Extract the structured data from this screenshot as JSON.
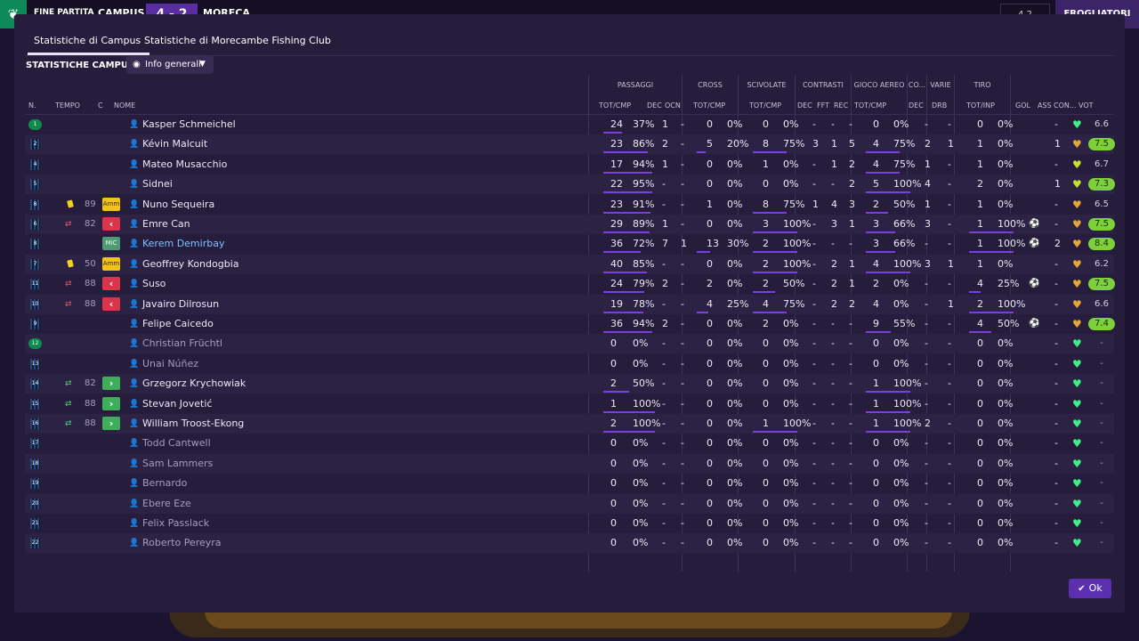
{
  "topbar": {
    "match_label": "FINE PARTITA",
    "home": "CAMPUS",
    "score": "4 - 2",
    "away": "MORECA",
    "right_small": "4 2",
    "right_button": "FROGLIATORI"
  },
  "tabs": [
    {
      "label": "Statistiche di Campus",
      "active": true
    },
    {
      "label": "Statistiche di Morecambe Fishing Club",
      "active": false
    }
  ],
  "section_title": "STATISTICHE CAMPUS",
  "view_dropdown": {
    "label": "Info generali"
  },
  "groups": [
    "PASSAGGI",
    "CROSS",
    "SCIVOLATE",
    "CONTRASTI",
    "GIOCO AEREO",
    "CO...",
    "VARIE",
    "TIRO"
  ],
  "columns": {
    "n": "N.",
    "tempo": "TEMPO",
    "c": "C",
    "nome": "NOME",
    "pass": "TOT/CMP",
    "dec": "DEC",
    "ocn": "OCN",
    "cross": "TOT/CMP",
    "sciv": "TOT/CMP",
    "cdec": "DEC",
    "fft": "FFT",
    "rec": "REC",
    "aereo": "TOT/CMP",
    "codec": "DEC",
    "drb": "DRB",
    "tiro": "TOT/INP",
    "gol": "GOL",
    "ass": "ASS",
    "con": "CON...",
    "vot": "VOT"
  },
  "players": [
    {
      "n": "1",
      "min": "",
      "chip": "",
      "name": "Kasper Schmeichel",
      "pt": "24",
      "pp": "37%",
      "pd": "1",
      "po": "-",
      "ct": "0",
      "cp": "0%",
      "st": "0",
      "sp": "0%",
      "kd": "-",
      "kf": "-",
      "kr": "-",
      "at": "0",
      "ap": "0%",
      "od": "-",
      "dr": "-",
      "tt": "0",
      "tp": "0%",
      "gol": "",
      "ass": "-",
      "con": "g",
      "vot": "6.6",
      "mult": 0.37
    },
    {
      "n": "2",
      "min": "",
      "chip": "",
      "name": "Kévin Malcuit",
      "pt": "23",
      "pp": "86%",
      "pd": "2",
      "po": "-",
      "ct": "5",
      "cp": "20%",
      "st": "8",
      "sp": "75%",
      "kd": "3",
      "kf": "1",
      "kr": "5",
      "at": "4",
      "ap": "75%",
      "od": "2",
      "dr": "1",
      "tt": "1",
      "tp": "0%",
      "gol": "",
      "ass": "1",
      "con": "o",
      "vot": "7.5"
    },
    {
      "n": "4",
      "min": "",
      "chip": "",
      "name": "Mateo Musacchio",
      "pt": "17",
      "pp": "94%",
      "pd": "1",
      "po": "-",
      "ct": "0",
      "cp": "0%",
      "st": "1",
      "sp": "0%",
      "kd": "-",
      "kf": "1",
      "kr": "2",
      "at": "4",
      "ap": "75%",
      "od": "1",
      "dr": "-",
      "tt": "1",
      "tp": "0%",
      "gol": "",
      "ass": "-",
      "con": "y",
      "vot": "6.7"
    },
    {
      "n": "5",
      "min": "",
      "chip": "",
      "name": "Sidnei",
      "pt": "22",
      "pp": "95%",
      "pd": "-",
      "po": "-",
      "ct": "0",
      "cp": "0%",
      "st": "0",
      "sp": "0%",
      "kd": "-",
      "kf": "-",
      "kr": "2",
      "at": "5",
      "ap": "100%",
      "od": "4",
      "dr": "-",
      "tt": "2",
      "tp": "0%",
      "gol": "",
      "ass": "1",
      "con": "y",
      "vot": "7.3"
    },
    {
      "n": "8",
      "min": "89",
      "chip": "Amm",
      "name": "Nuno Sequeira",
      "pt": "23",
      "pp": "91%",
      "pd": "-",
      "po": "-",
      "ct": "1",
      "cp": "0%",
      "st": "8",
      "sp": "75%",
      "kd": "1",
      "kf": "4",
      "kr": "3",
      "at": "2",
      "ap": "50%",
      "od": "1",
      "dr": "-",
      "tt": "1",
      "tp": "0%",
      "gol": "",
      "ass": "-",
      "con": "o",
      "vot": "6.5"
    },
    {
      "n": "6",
      "min": "82",
      "chip": "out",
      "name": "Emre Can",
      "pt": "29",
      "pp": "89%",
      "pd": "1",
      "po": "-",
      "ct": "0",
      "cp": "0%",
      "st": "3",
      "sp": "100%",
      "kd": "-",
      "kf": "3",
      "kr": "1",
      "at": "3",
      "ap": "66%",
      "od": "3",
      "dr": "-",
      "tt": "1",
      "tp": "100%",
      "gol": "ball",
      "ass": "-",
      "con": "o",
      "vot": "7.5"
    },
    {
      "n": "8",
      "min": "",
      "chip": "MiC",
      "name": "Kerem Demirbay",
      "pt": "36",
      "pp": "72%",
      "pd": "7",
      "po": "1",
      "ct": "13",
      "cp": "30%",
      "st": "2",
      "sp": "100%",
      "kd": "-",
      "kf": "-",
      "kr": "-",
      "at": "3",
      "ap": "66%",
      "od": "-",
      "dr": "-",
      "tt": "1",
      "tp": "100%",
      "gol": "ball",
      "ass": "2",
      "con": "o",
      "vot": "8.4",
      "link": true
    },
    {
      "n": "7",
      "min": "50",
      "chip": "Amm",
      "name": "Geoffrey Kondogbia",
      "pt": "40",
      "pp": "85%",
      "pd": "-",
      "po": "-",
      "ct": "0",
      "cp": "0%",
      "st": "2",
      "sp": "100%",
      "kd": "-",
      "kf": "2",
      "kr": "1",
      "at": "4",
      "ap": "100%",
      "od": "3",
      "dr": "1",
      "tt": "1",
      "tp": "0%",
      "gol": "",
      "ass": "-",
      "con": "o",
      "vot": "6.2"
    },
    {
      "n": "11",
      "min": "88",
      "chip": "out",
      "name": "Suso",
      "pt": "24",
      "pp": "79%",
      "pd": "2",
      "po": "-",
      "ct": "2",
      "cp": "0%",
      "st": "2",
      "sp": "50%",
      "kd": "-",
      "kf": "2",
      "kr": "1",
      "at": "2",
      "ap": "0%",
      "od": "-",
      "dr": "-",
      "tt": "4",
      "tp": "25%",
      "gol": "ball",
      "ass": "-",
      "con": "o",
      "vot": "7.5"
    },
    {
      "n": "10",
      "min": "88",
      "chip": "out",
      "name": "Javairo Dilrosun",
      "pt": "19",
      "pp": "78%",
      "pd": "-",
      "po": "-",
      "ct": "4",
      "cp": "25%",
      "st": "4",
      "sp": "75%",
      "kd": "-",
      "kf": "2",
      "kr": "2",
      "at": "4",
      "ap": "0%",
      "od": "-",
      "dr": "1",
      "tt": "2",
      "tp": "100%",
      "gol": "",
      "ass": "-",
      "con": "o",
      "vot": "6.6"
    },
    {
      "n": "9",
      "min": "",
      "chip": "",
      "name": "Felipe Caicedo",
      "pt": "36",
      "pp": "94%",
      "pd": "2",
      "po": "-",
      "ct": "0",
      "cp": "0%",
      "st": "2",
      "sp": "0%",
      "kd": "-",
      "kf": "-",
      "kr": "-",
      "at": "9",
      "ap": "55%",
      "od": "-",
      "dr": "-",
      "tt": "4",
      "tp": "50%",
      "gol": "ball",
      "ass": "-",
      "con": "o",
      "vot": "7.4"
    },
    {
      "n": "12",
      "min": "",
      "chip": "",
      "name": "Christian Früchtl",
      "pt": "0",
      "pp": "0%",
      "pd": "-",
      "po": "-",
      "ct": "0",
      "cp": "0%",
      "st": "0",
      "sp": "0%",
      "kd": "-",
      "kf": "-",
      "kr": "-",
      "at": "0",
      "ap": "0%",
      "od": "-",
      "dr": "-",
      "tt": "0",
      "tp": "0%",
      "gol": "",
      "ass": "-",
      "con": "g",
      "vot": "-",
      "dim": true
    },
    {
      "n": "13",
      "min": "",
      "chip": "",
      "name": "Unai Núñez",
      "pt": "0",
      "pp": "0%",
      "pd": "-",
      "po": "-",
      "ct": "0",
      "cp": "0%",
      "st": "0",
      "sp": "0%",
      "kd": "-",
      "kf": "-",
      "kr": "-",
      "at": "0",
      "ap": "0%",
      "od": "-",
      "dr": "-",
      "tt": "0",
      "tp": "0%",
      "gol": "",
      "ass": "-",
      "con": "g",
      "vot": "-",
      "dim": true
    },
    {
      "n": "14",
      "min": "82",
      "chip": "in",
      "name": "Grzegorz Krychowiak",
      "pt": "2",
      "pp": "50%",
      "pd": "-",
      "po": "-",
      "ct": "0",
      "cp": "0%",
      "st": "0",
      "sp": "0%",
      "kd": "-",
      "kf": "-",
      "kr": "-",
      "at": "1",
      "ap": "100%",
      "od": "-",
      "dr": "-",
      "tt": "0",
      "tp": "0%",
      "gol": "",
      "ass": "-",
      "con": "g",
      "vot": "-"
    },
    {
      "n": "15",
      "min": "88",
      "chip": "in",
      "name": "Stevan Jovetić",
      "pt": "1",
      "pp": "100%",
      "pd": "-",
      "po": "-",
      "ct": "0",
      "cp": "0%",
      "st": "0",
      "sp": "0%",
      "kd": "-",
      "kf": "-",
      "kr": "-",
      "at": "1",
      "ap": "100%",
      "od": "-",
      "dr": "-",
      "tt": "0",
      "tp": "0%",
      "gol": "",
      "ass": "-",
      "con": "g",
      "vot": "-"
    },
    {
      "n": "16",
      "min": "88",
      "chip": "in",
      "name": "William Troost-Ekong",
      "pt": "2",
      "pp": "100%",
      "pd": "-",
      "po": "-",
      "ct": "0",
      "cp": "0%",
      "st": "1",
      "sp": "100%",
      "kd": "-",
      "kf": "-",
      "kr": "-",
      "at": "1",
      "ap": "100%",
      "od": "2",
      "dr": "-",
      "tt": "0",
      "tp": "0%",
      "gol": "",
      "ass": "-",
      "con": "g",
      "vot": "-"
    },
    {
      "n": "17",
      "min": "",
      "chip": "",
      "name": "Todd Cantwell",
      "pt": "0",
      "pp": "0%",
      "pd": "-",
      "po": "-",
      "ct": "0",
      "cp": "0%",
      "st": "0",
      "sp": "0%",
      "kd": "-",
      "kf": "-",
      "kr": "-",
      "at": "0",
      "ap": "0%",
      "od": "-",
      "dr": "-",
      "tt": "0",
      "tp": "0%",
      "gol": "",
      "ass": "-",
      "con": "g",
      "vot": "-",
      "dim": true
    },
    {
      "n": "18",
      "min": "",
      "chip": "",
      "name": "Sam Lammers",
      "pt": "0",
      "pp": "0%",
      "pd": "-",
      "po": "-",
      "ct": "0",
      "cp": "0%",
      "st": "0",
      "sp": "0%",
      "kd": "-",
      "kf": "-",
      "kr": "-",
      "at": "0",
      "ap": "0%",
      "od": "-",
      "dr": "-",
      "tt": "0",
      "tp": "0%",
      "gol": "",
      "ass": "-",
      "con": "g",
      "vot": "-",
      "dim": true
    },
    {
      "n": "19",
      "min": "",
      "chip": "",
      "name": "Bernardo",
      "pt": "0",
      "pp": "0%",
      "pd": "-",
      "po": "-",
      "ct": "0",
      "cp": "0%",
      "st": "0",
      "sp": "0%",
      "kd": "-",
      "kf": "-",
      "kr": "-",
      "at": "0",
      "ap": "0%",
      "od": "-",
      "dr": "-",
      "tt": "0",
      "tp": "0%",
      "gol": "",
      "ass": "-",
      "con": "g",
      "vot": "-",
      "dim": true
    },
    {
      "n": "20",
      "min": "",
      "chip": "",
      "name": "Ebere Eze",
      "pt": "0",
      "pp": "0%",
      "pd": "-",
      "po": "-",
      "ct": "0",
      "cp": "0%",
      "st": "0",
      "sp": "0%",
      "kd": "-",
      "kf": "-",
      "kr": "-",
      "at": "0",
      "ap": "0%",
      "od": "-",
      "dr": "-",
      "tt": "0",
      "tp": "0%",
      "gol": "",
      "ass": "-",
      "con": "g",
      "vot": "-",
      "dim": true
    },
    {
      "n": "21",
      "min": "",
      "chip": "",
      "name": "Felix Passlack",
      "pt": "0",
      "pp": "0%",
      "pd": "-",
      "po": "-",
      "ct": "0",
      "cp": "0%",
      "st": "0",
      "sp": "0%",
      "kd": "-",
      "kf": "-",
      "kr": "-",
      "at": "0",
      "ap": "0%",
      "od": "-",
      "dr": "-",
      "tt": "0",
      "tp": "0%",
      "gol": "",
      "ass": "-",
      "con": "g",
      "vot": "-",
      "dim": true
    },
    {
      "n": "22",
      "min": "",
      "chip": "",
      "name": "Roberto Pereyra",
      "pt": "0",
      "pp": "0%",
      "pd": "-",
      "po": "-",
      "ct": "0",
      "cp": "0%",
      "st": "0",
      "sp": "0%",
      "kd": "-",
      "kf": "-",
      "kr": "-",
      "at": "0",
      "ap": "0%",
      "od": "-",
      "dr": "-",
      "tt": "0",
      "tp": "0%",
      "gol": "",
      "ass": "-",
      "con": "g",
      "vot": "-",
      "dim": true
    }
  ],
  "ok_button": "Ok",
  "colors": {
    "accent": "#7a3fe0",
    "card_yellow": "#f1c21b",
    "sub_out": "#d9364c",
    "sub_in": "#3fae5a",
    "rating_high": "#7ed03a"
  },
  "icons": [
    "logo-icon",
    "eye-icon",
    "chevron-down-icon",
    "person-icon",
    "yellow-card-icon",
    "sub-out-icon",
    "sub-in-icon",
    "heart-icon",
    "ball-icon",
    "check-icon"
  ]
}
